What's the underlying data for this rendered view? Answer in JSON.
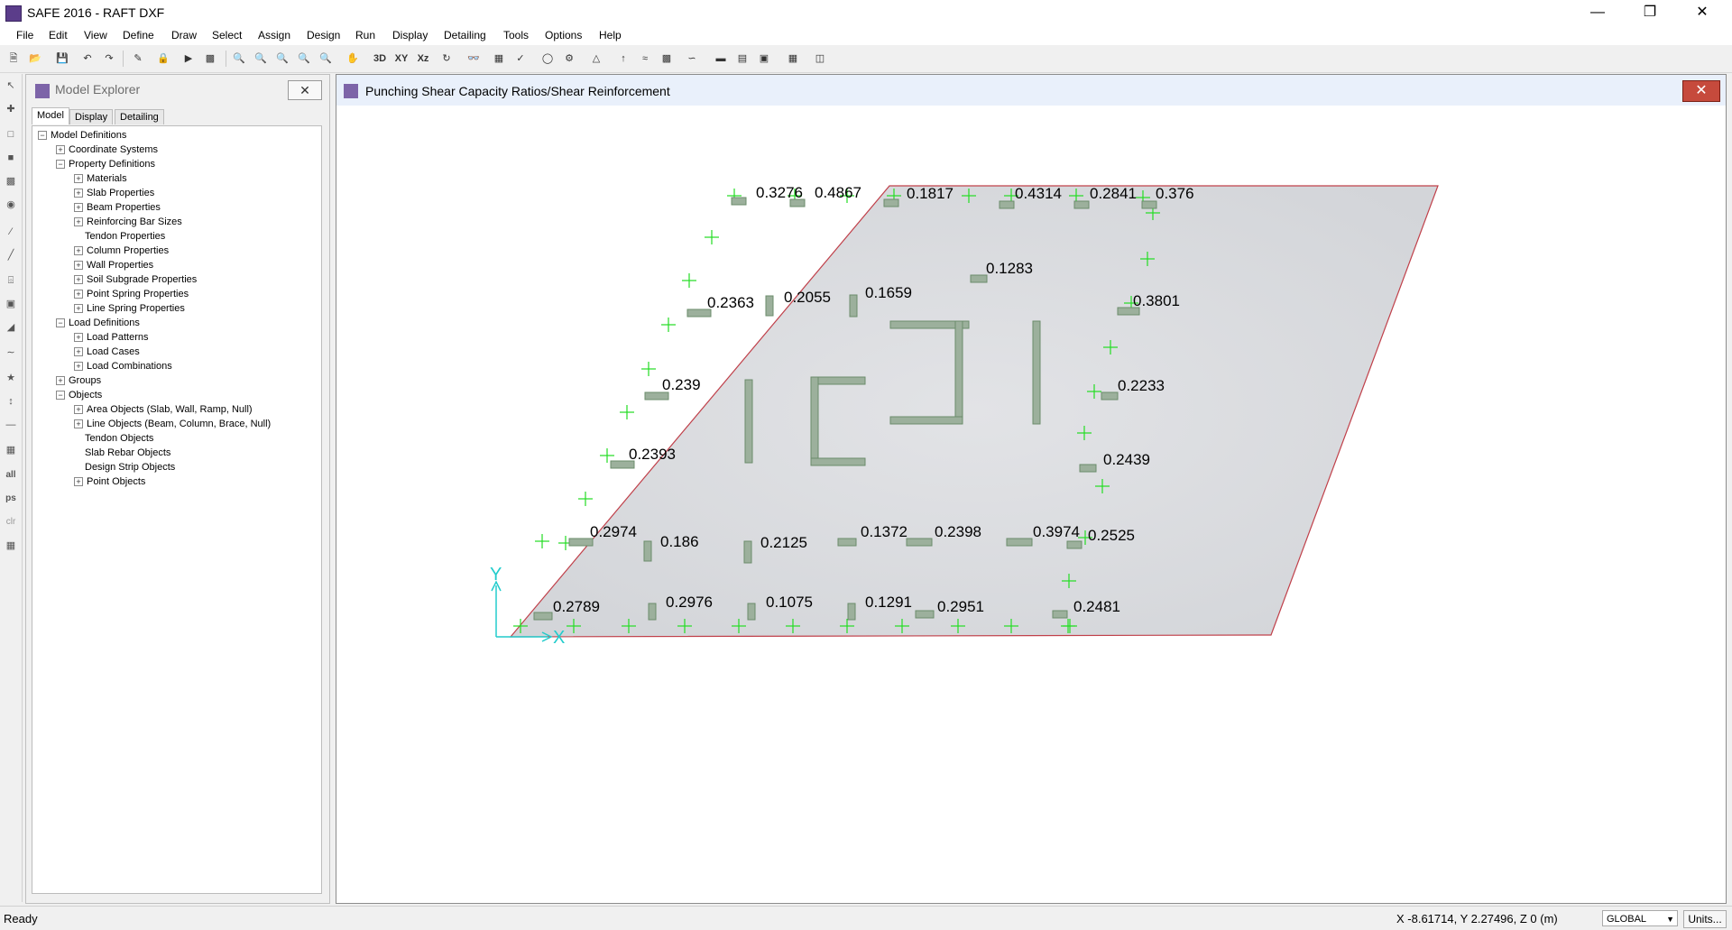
{
  "window": {
    "title": "SAFE 2016 - RAFT DXF",
    "controls": [
      "minimize-icon",
      "restore-icon",
      "close-icon"
    ]
  },
  "menu": [
    "File",
    "Edit",
    "View",
    "Define",
    "Draw",
    "Select",
    "Assign",
    "Design",
    "Run",
    "Display",
    "Detailing",
    "Tools",
    "Options",
    "Help"
  ],
  "toolbar": {
    "btn_3d": "3D",
    "btn_xy": "XY",
    "btn_xz": "Xz"
  },
  "left_toolbar": {
    "all": "all",
    "ps": "ps",
    "clr": "clr"
  },
  "explorer": {
    "title": "Model Explorer",
    "tabs": [
      "Model",
      "Display",
      "Detailing"
    ],
    "active_tab": "Model",
    "tree": [
      {
        "label": "Model Definitions",
        "level": 0,
        "toggle": "−"
      },
      {
        "label": "Coordinate Systems",
        "level": 1,
        "toggle": "+"
      },
      {
        "label": "Property Definitions",
        "level": 1,
        "toggle": "−"
      },
      {
        "label": "Materials",
        "level": 2,
        "toggle": "+"
      },
      {
        "label": "Slab Properties",
        "level": 2,
        "toggle": "+"
      },
      {
        "label": "Beam Properties",
        "level": 2,
        "toggle": "+"
      },
      {
        "label": "Reinforcing Bar Sizes",
        "level": 2,
        "toggle": "+"
      },
      {
        "label": "Tendon Properties",
        "level": 2,
        "toggle": ""
      },
      {
        "label": "Column Properties",
        "level": 2,
        "toggle": "+"
      },
      {
        "label": "Wall Properties",
        "level": 2,
        "toggle": "+"
      },
      {
        "label": "Soil Subgrade Properties",
        "level": 2,
        "toggle": "+"
      },
      {
        "label": "Point Spring Properties",
        "level": 2,
        "toggle": "+"
      },
      {
        "label": "Line Spring Properties",
        "level": 2,
        "toggle": "+"
      },
      {
        "label": "Load Definitions",
        "level": 1,
        "toggle": "−"
      },
      {
        "label": "Load Patterns",
        "level": 2,
        "toggle": "+"
      },
      {
        "label": "Load Cases",
        "level": 2,
        "toggle": "+"
      },
      {
        "label": "Load Combinations",
        "level": 2,
        "toggle": "+"
      },
      {
        "label": "Groups",
        "level": 1,
        "toggle": "+"
      },
      {
        "label": "Objects",
        "level": 1,
        "toggle": "−"
      },
      {
        "label": "Area Objects (Slab, Wall, Ramp, Null)",
        "level": 2,
        "toggle": "+"
      },
      {
        "label": "Line Objects (Beam, Column, Brace, Null)",
        "level": 2,
        "toggle": "+"
      },
      {
        "label": "Tendon Objects",
        "level": 2,
        "toggle": ""
      },
      {
        "label": "Slab Rebar Objects",
        "level": 2,
        "toggle": ""
      },
      {
        "label": "Design Strip Objects",
        "level": 2,
        "toggle": ""
      },
      {
        "label": "Point Objects",
        "level": 2,
        "toggle": "+"
      }
    ]
  },
  "view": {
    "title": "Punching Shear Capacity Ratios/Shear Reinforcement",
    "axis_x": "X",
    "axis_y": "Y",
    "ratios": [
      {
        "label": "0.3276"
      },
      {
        "label": "0.4867"
      },
      {
        "label": "0.1817"
      },
      {
        "label": "0.4314"
      },
      {
        "label": "0.2841"
      },
      {
        "label": "0.376"
      },
      {
        "label": "0.1283"
      },
      {
        "label": "0.2363"
      },
      {
        "label": "0.2055"
      },
      {
        "label": "0.1659"
      },
      {
        "label": "0.3801"
      },
      {
        "label": "0.239"
      },
      {
        "label": "0.2233"
      },
      {
        "label": "0.2393"
      },
      {
        "label": "0.2439"
      },
      {
        "label": "0.2974"
      },
      {
        "label": "0.186"
      },
      {
        "label": "0.2125"
      },
      {
        "label": "0.1372"
      },
      {
        "label": "0.2398"
      },
      {
        "label": "0.3974"
      },
      {
        "label": "0.2525"
      },
      {
        "label": "0.2789"
      },
      {
        "label": "0.2976"
      },
      {
        "label": "0.1075"
      },
      {
        "label": "0.1291"
      },
      {
        "label": "0.2951"
      },
      {
        "label": "0.2481"
      }
    ],
    "colors": {
      "slab_fill": "#d7d9dd",
      "slab_edge": "#c0404a",
      "column_fill": "#9cb09c",
      "point_marker": "#22dd22",
      "axis": "#22cccc"
    }
  },
  "status": {
    "text": "Ready",
    "coords": "X -8.61714,  Y 2.27496,  Z 0  (m)",
    "coord_system": "GLOBAL",
    "units_button": "Units..."
  }
}
